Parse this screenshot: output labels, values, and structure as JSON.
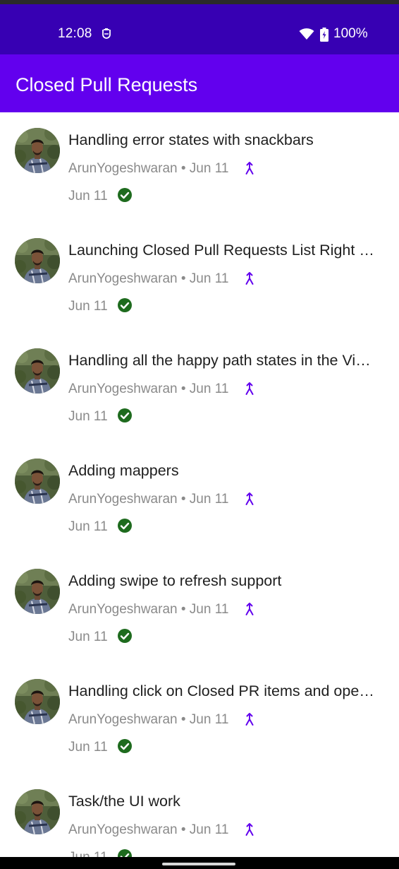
{
  "status_bar": {
    "time": "12:08",
    "battery": "100%",
    "left_icon": "shield-icon",
    "wifi_icon": "wifi-icon",
    "battery_icon": "battery-charging-icon"
  },
  "app_bar": {
    "title": "Closed Pull Requests",
    "color": "#6200EE"
  },
  "colors": {
    "status_bar": "#3700B3",
    "accent": "#6200EE",
    "merge_icon": "#6200EE",
    "check_icon": "#1E6B1E",
    "secondary_text": "#8A8A8A"
  },
  "pull_requests": [
    {
      "title": "Handling error states with snackbars",
      "meta": "ArunYogeshwaran • Jun 11",
      "closed_date": "Jun 11"
    },
    {
      "title": "Launching Closed Pull Requests List Right from the Main Activity",
      "meta": "ArunYogeshwaran • Jun 11",
      "closed_date": "Jun 11"
    },
    {
      "title": "Handling all the happy path states in the ViewModel",
      "meta": "ArunYogeshwaran • Jun 11",
      "closed_date": "Jun 11"
    },
    {
      "title": "Adding mappers",
      "meta": "ArunYogeshwaran • Jun 11",
      "closed_date": "Jun 11"
    },
    {
      "title": "Adding swipe to refresh support",
      "meta": "ArunYogeshwaran • Jun 11",
      "closed_date": "Jun 11"
    },
    {
      "title": "Handling click on Closed PR items and opening in browser",
      "meta": "ArunYogeshwaran • Jun 11",
      "closed_date": "Jun 11"
    },
    {
      "title": "Task/the UI work",
      "meta": "ArunYogeshwaran • Jun 11",
      "closed_date": "Jun 11"
    }
  ]
}
